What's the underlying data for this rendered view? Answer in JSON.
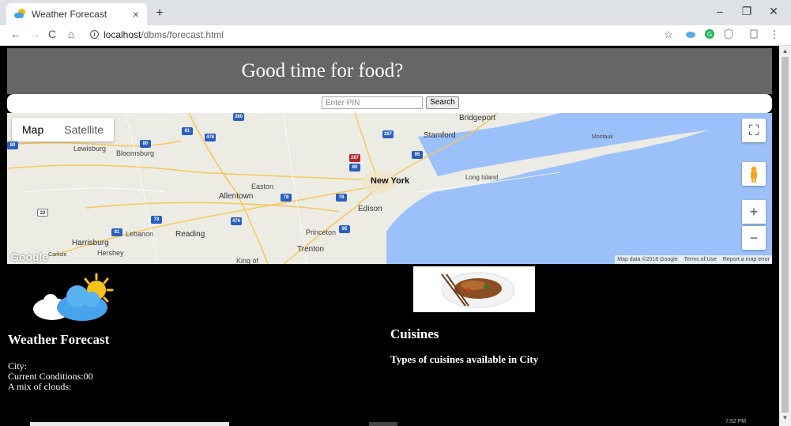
{
  "browser": {
    "tab_title": "Weather Forecast",
    "tab_close": "×",
    "new_tab": "+",
    "url_host": "localhost",
    "url_path": "/dbms/forecast.html",
    "window_controls": {
      "minimize": "–",
      "restore": "❐",
      "close": "✕"
    },
    "nav": {
      "back": "←",
      "forward": "→",
      "reload": "C",
      "home": "⌂"
    },
    "right_icons": [
      "star-icon",
      "cloud-extension-icon",
      "green-extension-icon",
      "shield-extension-icon",
      "profile-extension-icon",
      "menu-icon"
    ]
  },
  "page": {
    "banner_title": "Good time for food?",
    "search": {
      "placeholder": "Enter PIN",
      "button_label": "Search"
    },
    "map": {
      "tabs": [
        "Map",
        "Satellite"
      ],
      "active_tab": "Map",
      "labels": {
        "bridgeport": "Bridgeport",
        "stamford": "Stamford",
        "montauk": "Montauk",
        "lewisburg": "Lewisburg",
        "bloomsburg": "Bloomsburg",
        "easton": "Easton",
        "allentown": "Allentown",
        "new_york": "New York",
        "long_island": "Long Island",
        "edison": "Edison",
        "lebanon": "Lebanon",
        "reading": "Reading",
        "princeton": "Princeton",
        "harrisburg": "Harrisburg",
        "hershey": "Hershey",
        "trenton": "Trenton",
        "carlisle": "Carlisle",
        "king_of": "King of"
      },
      "google_logo": "Google",
      "footer": {
        "data": "Map data ©2018 Google",
        "terms": "Terms of Use",
        "report": "Report a map error"
      },
      "zoom_in": "+",
      "zoom_out": "−"
    },
    "weather": {
      "title": "Weather Forecast",
      "city": "City:",
      "conditions": "Current Conditions:00",
      "summary": "A mix of clouds:"
    },
    "cuisines": {
      "title": "Cuisines",
      "subtitle": "Types of cuisines available in City"
    }
  },
  "taskbar": {
    "time": "7:52 PM"
  },
  "colors": {
    "banner_bg": "#666666",
    "page_bg": "#000000",
    "water": "#9cc0f9",
    "land": "#ecebe4"
  }
}
